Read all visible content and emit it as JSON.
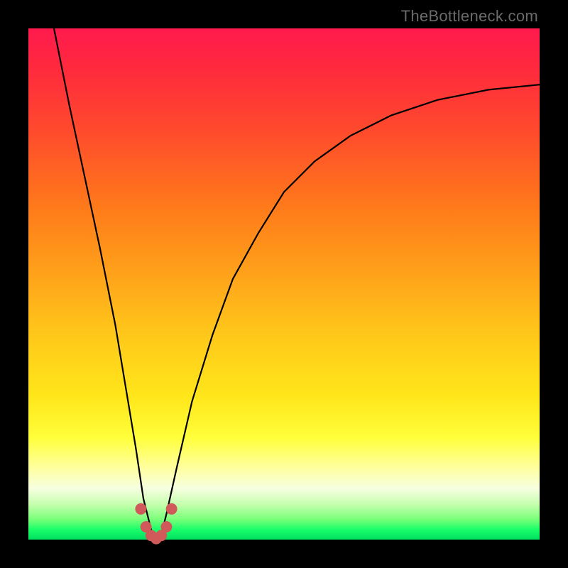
{
  "watermark": "TheBottleneck.com",
  "chart_data": {
    "type": "line",
    "title": "",
    "xlabel": "",
    "ylabel": "",
    "xlim": [
      0,
      100
    ],
    "ylim": [
      0,
      100
    ],
    "series": [
      {
        "name": "bottleneck-curve",
        "x": [
          5,
          8,
          11,
          14,
          17,
          19,
          21,
          22.5,
          24,
          25,
          26,
          27,
          29,
          32,
          36,
          40,
          45,
          50,
          56,
          63,
          71,
          80,
          90,
          100
        ],
        "values": [
          100,
          85,
          71,
          57,
          42,
          30,
          18,
          8,
          2,
          0,
          1,
          5,
          14,
          27,
          40,
          51,
          60,
          68,
          74,
          79,
          83,
          86,
          88,
          89
        ]
      },
      {
        "name": "highlight-dots",
        "x": [
          22.0,
          23.0,
          24.0,
          25.0,
          26.0,
          27.0,
          28.0
        ],
        "values": [
          6.0,
          2.5,
          0.8,
          0.2,
          0.8,
          2.5,
          6.0
        ]
      }
    ],
    "colors": {
      "curve": "#000000",
      "dots": "#d05a5a",
      "gradient_top": "#ff1a4d",
      "gradient_bottom": "#00e060"
    }
  }
}
